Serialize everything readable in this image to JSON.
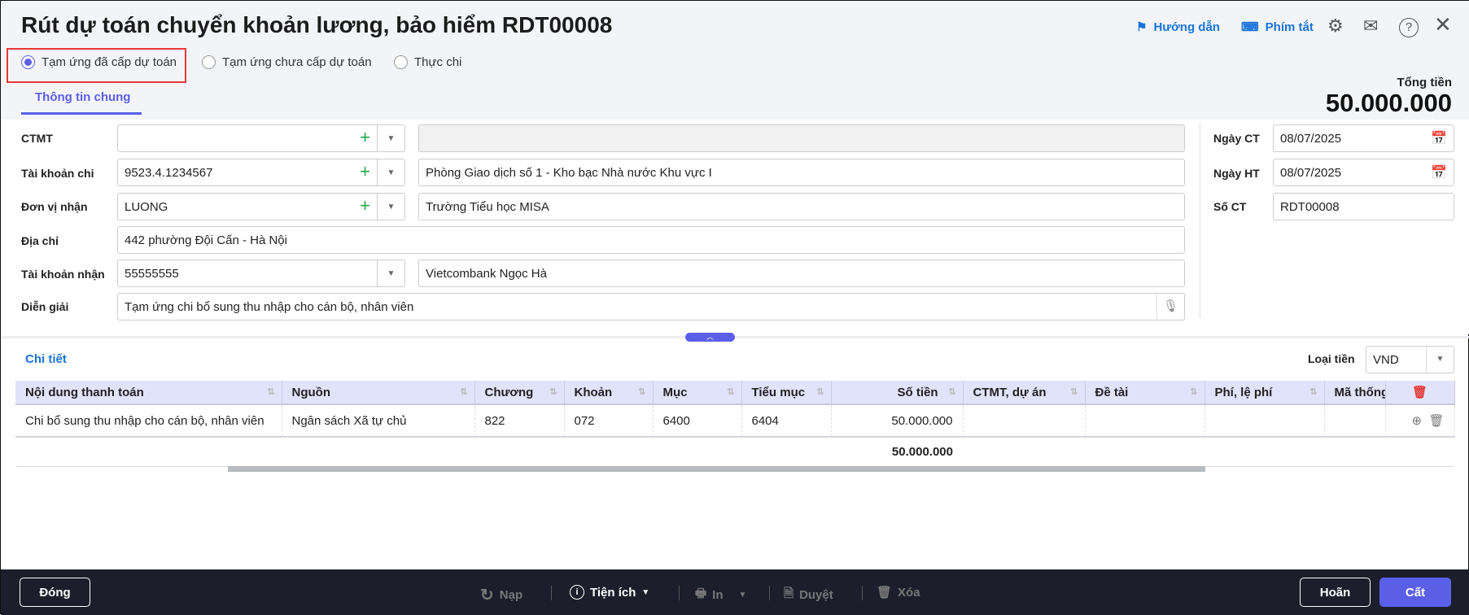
{
  "header": {
    "title": "Rút dự toán chuyển khoản lương, bảo hiểm RDT00008",
    "guide": "Hướng dẫn",
    "shortcuts": "Phím tắt",
    "total_label": "Tổng tiền",
    "total_value": "50.000.000"
  },
  "modes": [
    {
      "label": "Tạm ứng đã cấp dự toán",
      "selected": true
    },
    {
      "label": "Tạm ứng chưa cấp dự toán",
      "selected": false
    },
    {
      "label": "Thực chi",
      "selected": false
    }
  ],
  "tabs": [
    "Thông tin chung"
  ],
  "form": {
    "ctmt": {
      "label": "CTMT",
      "value": "",
      "name": ""
    },
    "account": {
      "label": "Tài khoản chi",
      "value": "9523.4.1234567",
      "name": "Phòng Giao dịch số 1 - Kho bạc Nhà nước Khu vực I"
    },
    "unit": {
      "label": "Đơn vị nhận",
      "value": "LUONG",
      "name": "Trường Tiểu học MISA"
    },
    "address": {
      "label": "Địa chỉ",
      "value": "442 phường Đội Cấn - Hà Nội"
    },
    "recv": {
      "label": "Tài khoản nhận",
      "value": "55555555",
      "name": "Vietcombank Ngọc Hà"
    },
    "desc": {
      "label": "Diễn giải",
      "value": "Tạm ứng chi bổ sung thu nhập cho cán bộ, nhân viên"
    },
    "date_ct": {
      "label": "Ngày CT",
      "value": "08/07/2025"
    },
    "date_ht": {
      "label": "Ngày HT",
      "value": "08/07/2025"
    },
    "no_ct": {
      "label": "Số CT",
      "value": "RDT00008"
    }
  },
  "detail": {
    "title": "Chi tiết",
    "currency_label": "Loại tiền",
    "currency": "VND",
    "columns": [
      "Nội dung thanh toán",
      "Nguồn",
      "Chương",
      "Khoản",
      "Mục",
      "Tiểu mục",
      "Số tiền",
      "CTMT, dự án",
      "Đề tài",
      "Phí, lệ phí",
      "Mã thống"
    ],
    "rows": [
      [
        "Chi bổ sung thu nhập cho cán bộ, nhân viên",
        "Ngân sách Xã tự chủ",
        "822",
        "072",
        "6400",
        "6404",
        "50.000.000",
        "",
        "",
        "",
        ""
      ]
    ],
    "total": "50.000.000"
  },
  "footer": {
    "close": "Đóng",
    "reload": "Nạp",
    "utilities": "Tiện ích",
    "print": "In",
    "approve": "Duyệt",
    "delete": "Xóa",
    "postpone": "Hoãn",
    "save": "Cất"
  },
  "colors": {
    "accent": "#5b5fe8",
    "link": "#1a73d9",
    "footer": "#1c1f2b",
    "highlight": "#e53935"
  }
}
